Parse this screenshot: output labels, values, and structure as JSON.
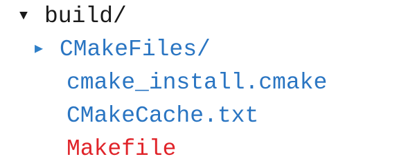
{
  "colors": {
    "default_text": "#1a1a1a",
    "directory_blue": "#2a75c2",
    "file_blue": "#2a75c2",
    "modified_red": "#e0242a"
  },
  "tree": {
    "root": {
      "expand_icon": "triangle-down-icon",
      "expand_glyph": "▼",
      "label": "build/"
    },
    "children": [
      {
        "expand_icon": "triangle-right-icon",
        "expand_glyph": "▶",
        "label": "CMakeFiles/"
      },
      {
        "label": "cmake_install.cmake"
      },
      {
        "label": "CMakeCache.txt"
      },
      {
        "label": "Makefile"
      }
    ]
  }
}
